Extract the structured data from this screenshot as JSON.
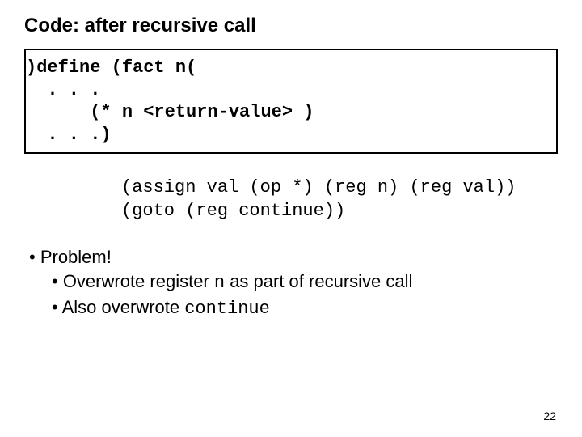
{
  "title": "Code: after recursive call",
  "code": {
    "l1": ")define (fact n(",
    "l2": "  . . .",
    "l3": "      (* n <return-value> )",
    "l4": "  . . .)"
  },
  "asm": {
    "l1": "(assign val (op *) (reg n) (reg val))",
    "l2": "(goto (reg continue))"
  },
  "bullets": {
    "b1": "• Problem!",
    "b2a": "• Overwrote register ",
    "b2b": "n",
    "b2c": " as part of recursive call",
    "b3a": "• Also overwrote ",
    "b3b": "continue"
  },
  "pagenum": "22"
}
